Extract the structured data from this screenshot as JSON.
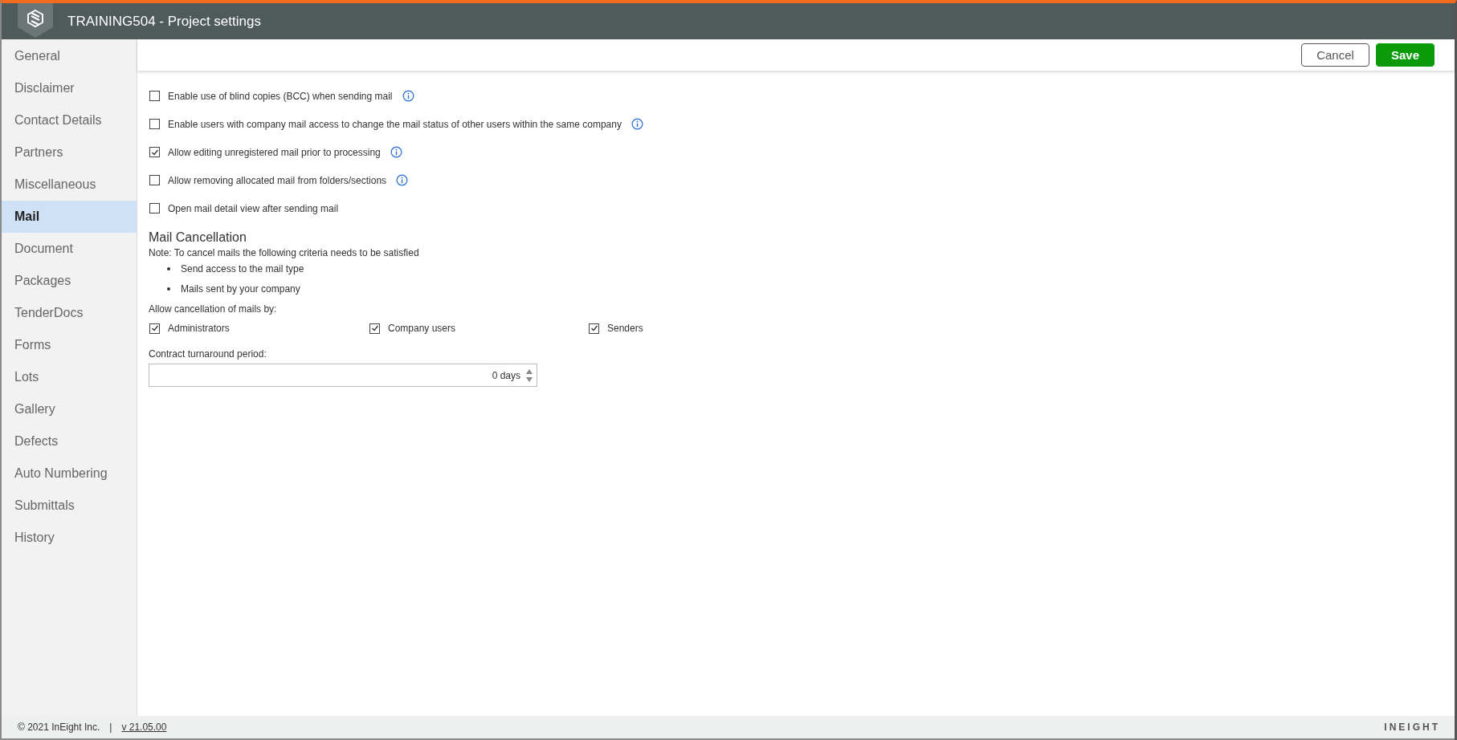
{
  "window": {
    "title": "TRAINING504 - Project settings"
  },
  "sidebar": {
    "items": [
      {
        "label": "General",
        "selected": false
      },
      {
        "label": "Disclaimer",
        "selected": false
      },
      {
        "label": "Contact Details",
        "selected": false
      },
      {
        "label": "Partners",
        "selected": false
      },
      {
        "label": "Miscellaneous",
        "selected": false
      },
      {
        "label": "Mail",
        "selected": true
      },
      {
        "label": "Document",
        "selected": false
      },
      {
        "label": "Packages",
        "selected": false
      },
      {
        "label": "TenderDocs",
        "selected": false
      },
      {
        "label": "Forms",
        "selected": false
      },
      {
        "label": "Lots",
        "selected": false
      },
      {
        "label": "Gallery",
        "selected": false
      },
      {
        "label": "Defects",
        "selected": false
      },
      {
        "label": "Auto Numbering",
        "selected": false
      },
      {
        "label": "Submittals",
        "selected": false
      },
      {
        "label": "History",
        "selected": false
      }
    ]
  },
  "toolbar": {
    "buttons": [
      {
        "label": "Cancel",
        "kind": "secondary"
      },
      {
        "label": "Save",
        "kind": "primary"
      }
    ]
  },
  "options": [
    {
      "label": "Enable use of blind copies (BCC) when sending mail",
      "checked": false,
      "info": true
    },
    {
      "label": "Enable users with company mail access to change the mail status of other users within the same company",
      "checked": false,
      "info": true
    },
    {
      "label": "Allow editing unregistered mail prior to processing",
      "checked": true,
      "info": true
    },
    {
      "label": "Allow removing allocated mail from folders/sections",
      "checked": false,
      "info": true
    },
    {
      "label": "Open mail detail view after sending mail",
      "checked": false,
      "info": false
    }
  ],
  "mail_cancellation": {
    "title": "Mail Cancellation",
    "note": "Note: To cancel mails the following criteria needs to be satisfied",
    "criteria": [
      "Send access to the mail type",
      "Mails sent by your company"
    ],
    "allow_label": "Allow cancellation of mails by:",
    "allowed": [
      {
        "label": "Administrators",
        "checked": true
      },
      {
        "label": "Company users",
        "checked": true
      },
      {
        "label": "Senders",
        "checked": true
      }
    ],
    "turnaround_label": "Contract turnaround period:",
    "turnaround_value": "0 days"
  },
  "footer": {
    "copyright": "© 2021 InEight Inc.",
    "separator": "|",
    "version": "v 21.05.00",
    "brand": "INEIGHT"
  }
}
